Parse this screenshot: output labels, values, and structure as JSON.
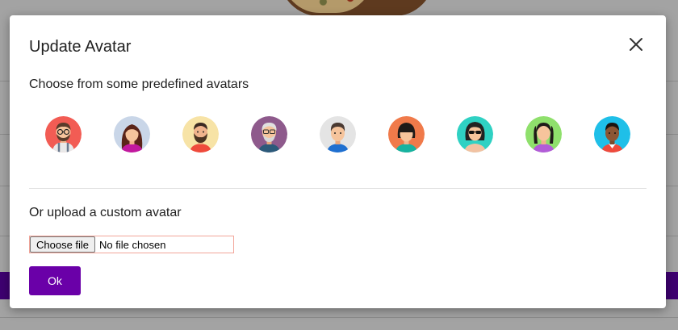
{
  "dialog": {
    "title": "Update Avatar",
    "predefined_label": "Choose from some predefined avatars",
    "upload_label": "Or upload a custom avatar",
    "file_button_label": "Choose file",
    "file_status": "No file chosen",
    "ok_label": "Ok",
    "close_icon": "close-icon"
  },
  "avatars": [
    {
      "name": "avatar-glasses-beard-man",
      "bg": "#f25c54"
    },
    {
      "name": "avatar-long-hair-woman",
      "bg": "#c9d6e8"
    },
    {
      "name": "avatar-bearded-man",
      "bg": "#f7e3a6"
    },
    {
      "name": "avatar-old-man-glasses",
      "bg": "#8e5a8c"
    },
    {
      "name": "avatar-short-hair-man",
      "bg": "#e4e4e4"
    },
    {
      "name": "avatar-bob-hair-woman",
      "bg": "#f07a4a"
    },
    {
      "name": "avatar-sunglasses-woman",
      "bg": "#2fd1c3"
    },
    {
      "name": "avatar-pigtails-woman",
      "bg": "#8fe06c"
    },
    {
      "name": "avatar-dark-skin-man",
      "bg": "#1fbfe8"
    }
  ],
  "colors": {
    "primary": "#6a00a8",
    "input_border": "#f2a59a",
    "background_bar": "#3e0070"
  }
}
